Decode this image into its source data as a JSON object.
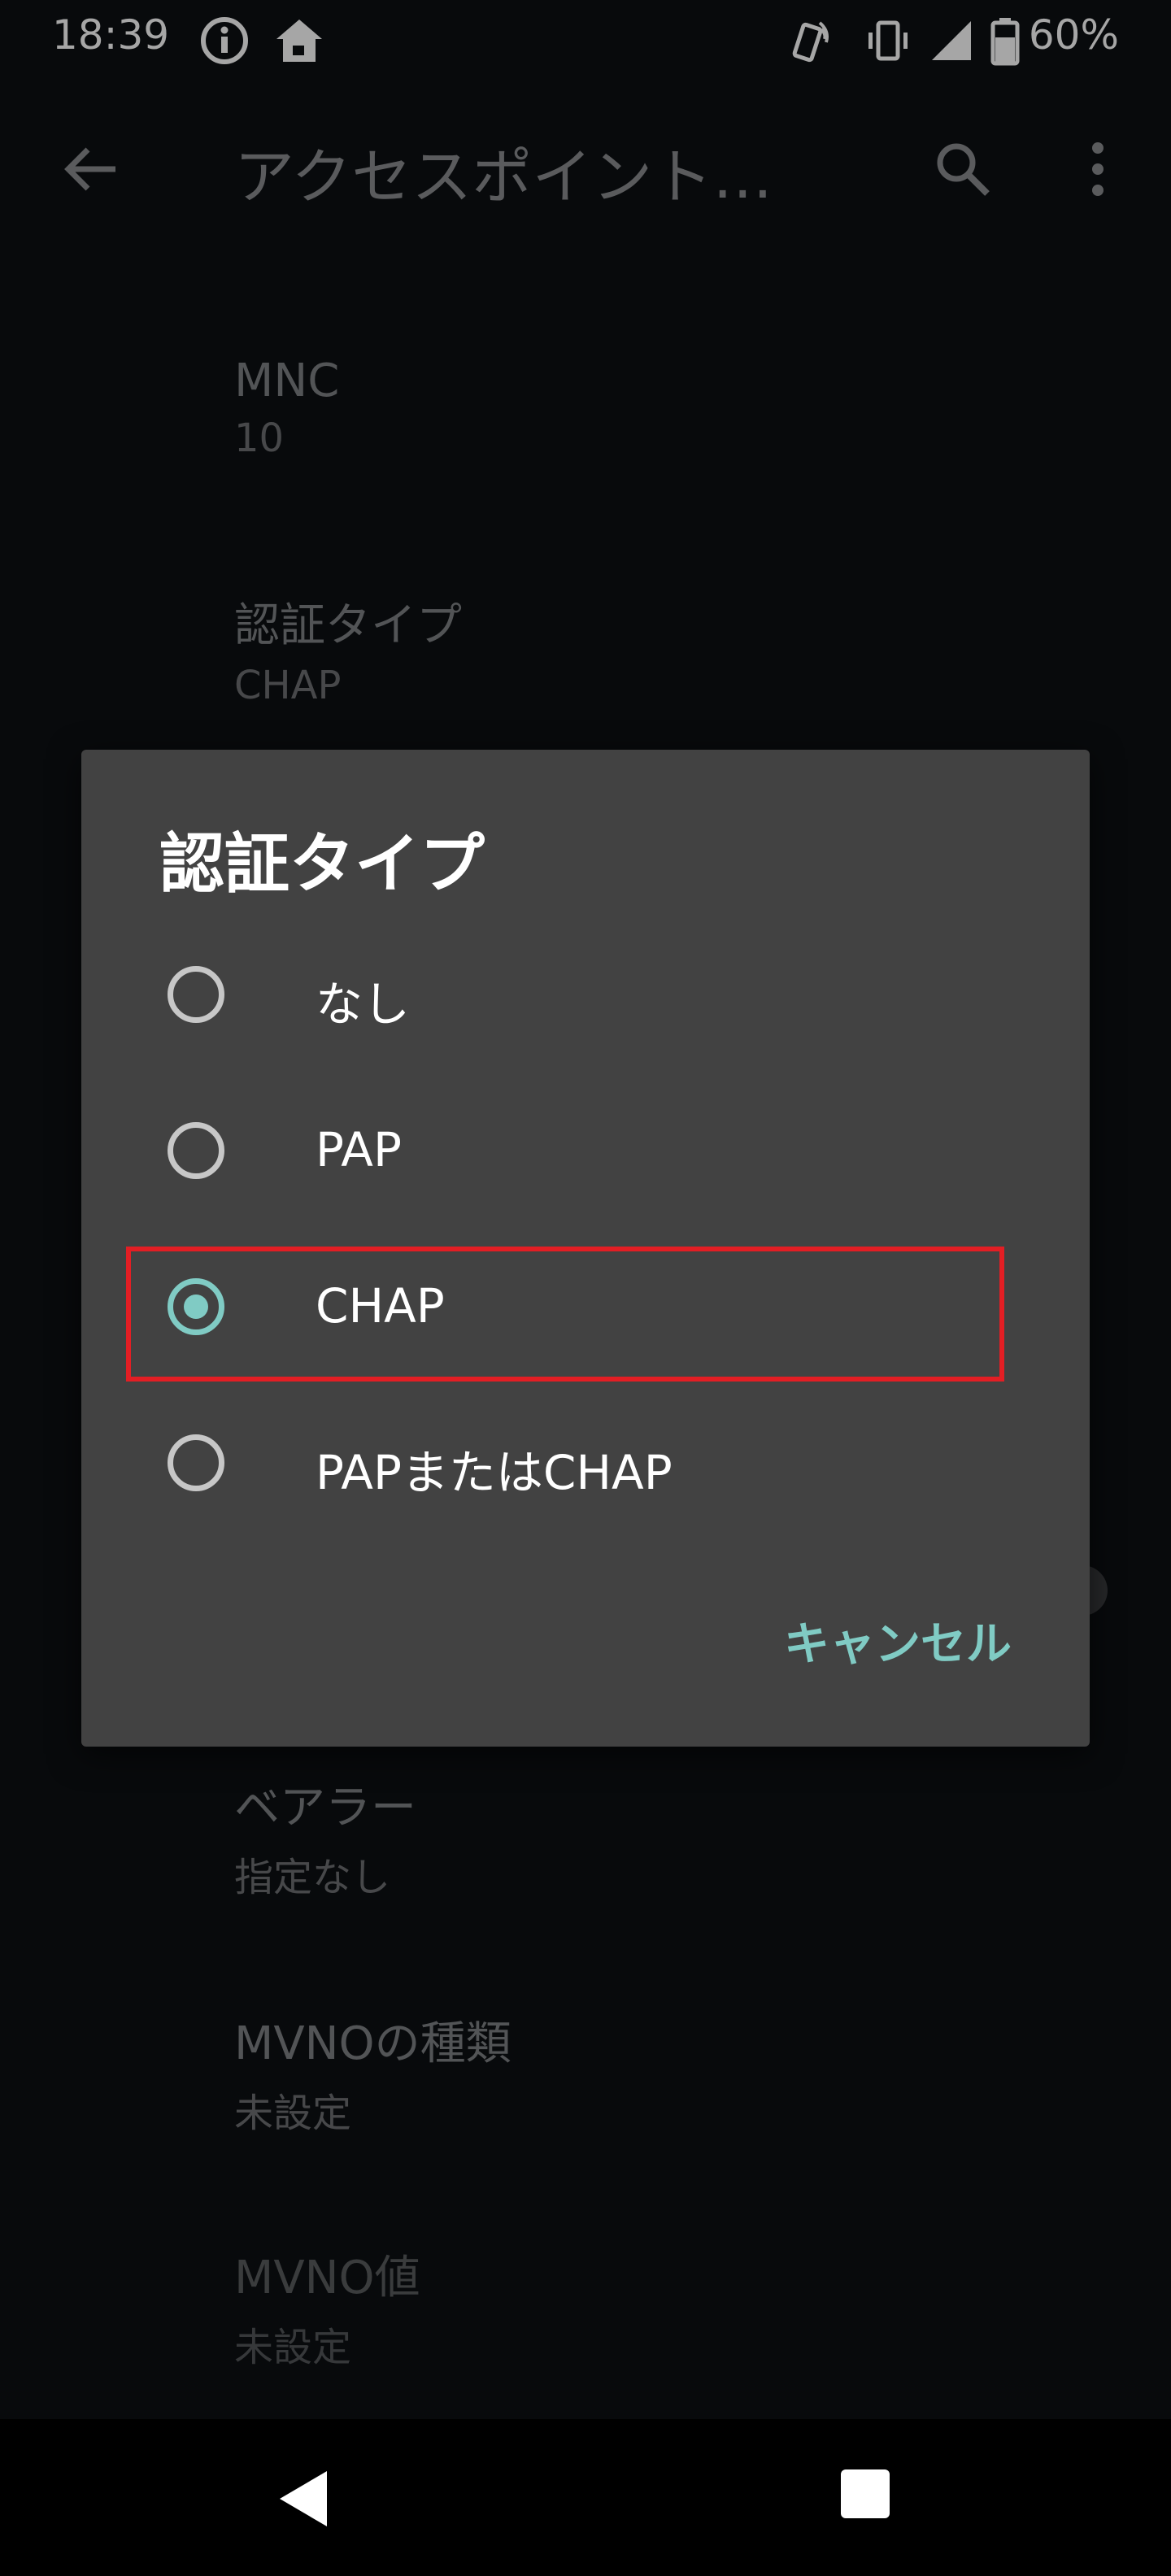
{
  "status_bar": {
    "time": "18:39",
    "battery": "60%",
    "icons": [
      "info-icon",
      "home-icon",
      "nfc-icon",
      "vibrate-icon",
      "signal-icon",
      "battery-icon"
    ]
  },
  "app_bar": {
    "title": "アクセスポイント…",
    "icons": [
      "back-arrow-icon",
      "search-icon",
      "more-vert-icon"
    ]
  },
  "preferences": [
    {
      "title": "MNC",
      "summary": "10"
    },
    {
      "title": "認証タイプ",
      "summary": "CHAP"
    },
    {
      "title": "ベアラー",
      "summary": "指定なし"
    },
    {
      "title": "MVNOの種類",
      "summary": "未設定"
    },
    {
      "title": "MVNO値",
      "summary": "未設定"
    }
  ],
  "dialog": {
    "title": "認証タイプ",
    "options": [
      {
        "label": "なし",
        "selected": false
      },
      {
        "label": "PAP",
        "selected": false
      },
      {
        "label": "CHAP",
        "selected": true
      },
      {
        "label": "PAPまたはCHAP",
        "selected": false
      }
    ],
    "cancel_label": "キャンセル",
    "accent_color": "#80cbc4"
  },
  "highlight_color": "#e31e24",
  "nav_bar": {
    "icons": [
      "nav-back-icon",
      "nav-recents-icon"
    ]
  }
}
